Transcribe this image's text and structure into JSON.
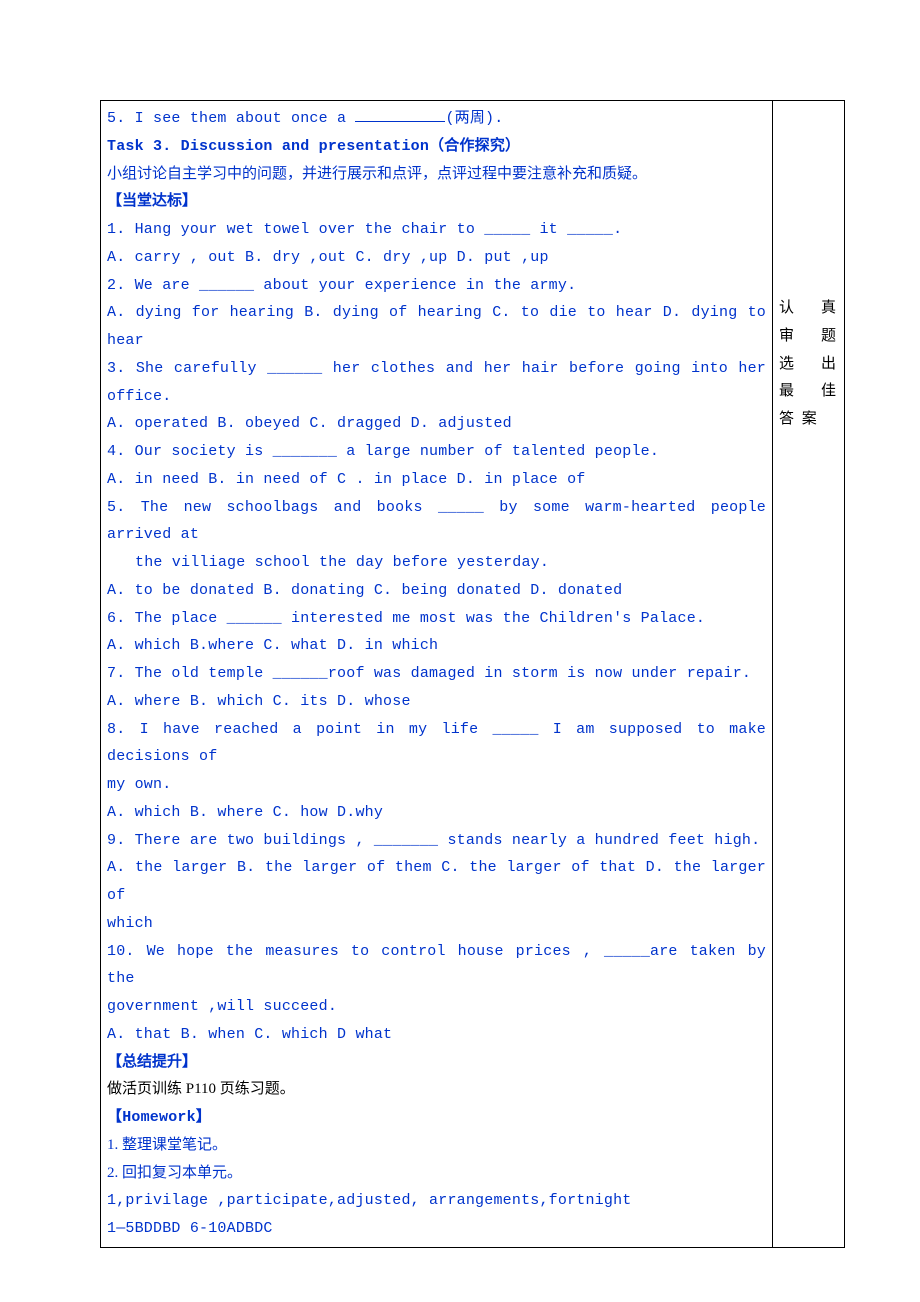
{
  "q5_prefix": "5. I see them about once a ",
  "q5_suffix": "(两周).",
  "task3": "Task 3. Discussion and presentation（合作探究）",
  "task3_desc": "小组讨论自主学习中的问题，并进行展示和点评，点评过程中要注意补充和质疑。",
  "sec_dangtang": "【当堂达标】",
  "items": {
    "q1": "1.  Hang your wet towel over the chair to _____ it _____.",
    "q1opts": "A.  carry , out  B. dry ,out  C. dry ,up  D. put ,up",
    "q2": "2.  We are ______ about your experience in the army.",
    "q2opts": "A.  dying for hearing  B. dying of hearing  C. to die to hear  D. dying to hear",
    "q3": "3.  She carefully ______ her clothes and her hair before going into her office.",
    "q3opts": "A.  operated  B. obeyed  C. dragged  D. adjusted",
    "q4": "4.  Our society is _______ a large number of talented people.",
    "q4opts": "A.  in need  B. in need of  C . in place  D. in place of",
    "q5b": "5.  The new schoolbags and books _____ by some warm-hearted people arrived at",
    "q5b2": "the villiage school the day before yesterday.",
    "q5bopts": "A. to be donated  B. donating  C. being donated  D. donated",
    "q6": "6. The place ______ interested me most was the Children's Palace.",
    "q6opts": "A. which  B.where  C. what  D. in which",
    "q7": "7. The old temple ______roof was damaged in storm is now under repair.",
    "q7opts": "A. where  B. which  C. its  D. whose",
    "q8": "8. I have reached a point in my life _____ I am supposed to make decisions of",
    "q8b": "my own.",
    "q8opts": "A. which  B. where  C. how  D.why",
    "q9": "9. There are two buildings , _______ stands nearly a hundred feet high.",
    "q9opts": "A. the larger B. the larger of them  C. the larger of that  D. the larger of",
    "q9opts2": "which",
    "q10": "10. We hope the measures to control house prices , _____are taken by the",
    "q10b": "government ,will succeed.",
    "q10opts": "A. that  B. when  C. which  D what"
  },
  "sec_zongjie": "【总结提升】",
  "zongjie_line": "做活页训练 P110 页练习题。",
  "sec_hw": "【Homework】",
  "hw1": "1. 整理课堂笔记。",
  "hw2": "2. 回扣复习本单元。",
  "ans1": "1,privilage ,participate,adjusted, arrangements,fortnight",
  "ans2": "1—5BDDBD 6-10ADBDC",
  "side_note": "认 真 审 题 选 出 最 佳 答 案"
}
